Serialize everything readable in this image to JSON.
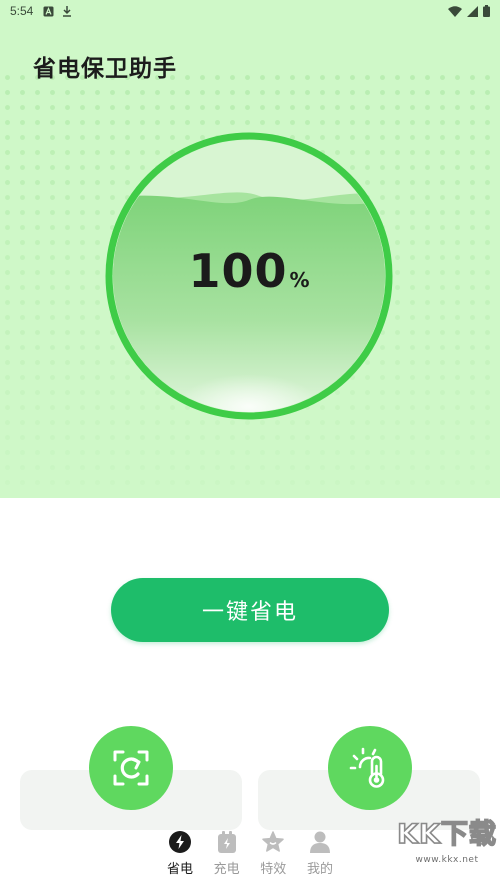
{
  "status_bar": {
    "time": "5:54",
    "left_icons": [
      "a-notification-icon",
      "download-icon"
    ],
    "right_icons": [
      "wifi-icon",
      "signal-icon",
      "battery-icon"
    ]
  },
  "app": {
    "title": "省电保卫助手"
  },
  "battery_gauge": {
    "value": "100",
    "unit": "%",
    "level_fraction": 0.78
  },
  "actions": {
    "save_button_label": "一键省电"
  },
  "feature_cards": [
    {
      "icon": "refresh-screen-icon"
    },
    {
      "icon": "thermometer-sun-icon"
    }
  ],
  "tabbar": {
    "active_index": 0,
    "tabs": [
      {
        "label": "省电",
        "icon": "lightning-icon"
      },
      {
        "label": "充电",
        "icon": "battery-charge-icon"
      },
      {
        "label": "特效",
        "icon": "star-icon"
      },
      {
        "label": "我的",
        "icon": "profile-icon"
      }
    ]
  },
  "watermark": {
    "logo": "KK下载",
    "url": "www.kkx.net"
  },
  "colors": {
    "hero_background": "#cff8c8",
    "gauge_ring": "#3fcc47",
    "primary_button": "#1ebd6a",
    "feature_circle": "#5fd85f"
  }
}
